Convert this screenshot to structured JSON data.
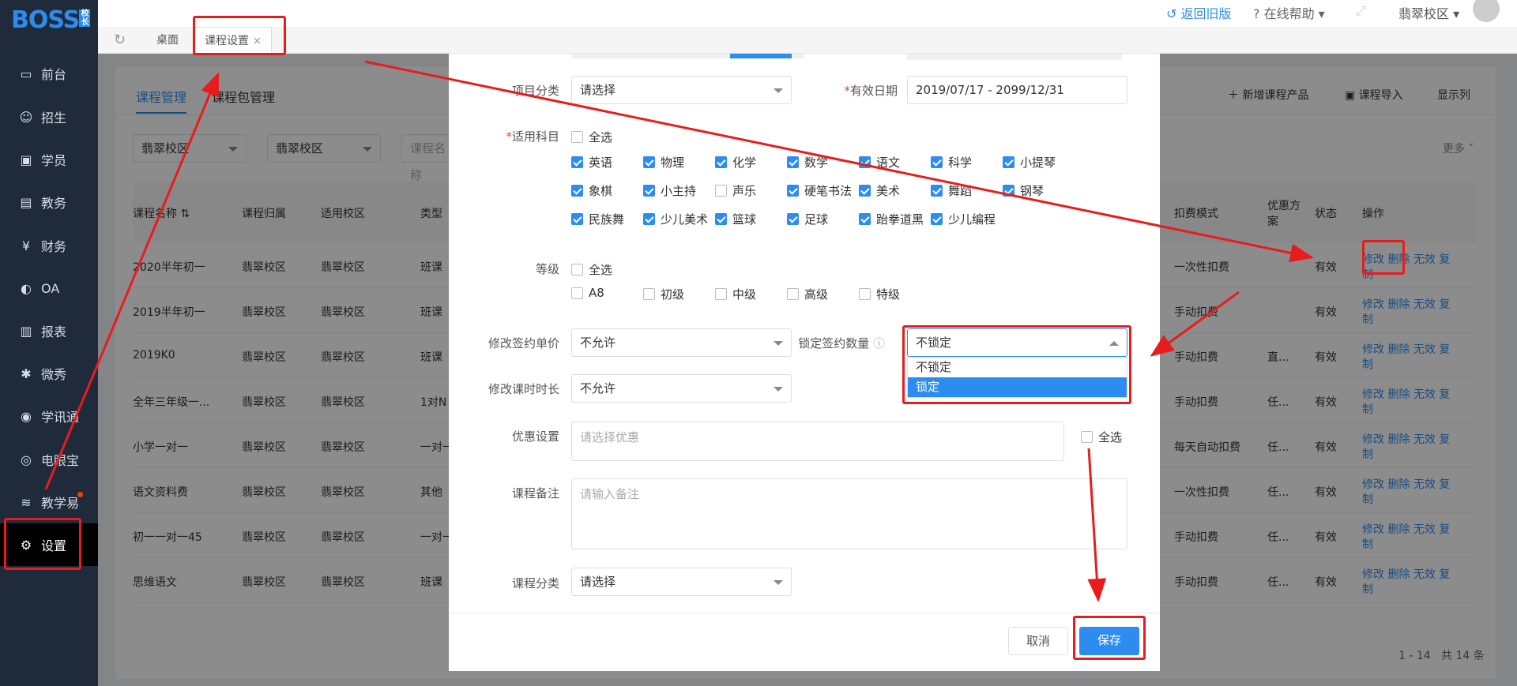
{
  "app": {
    "logo": "BOSS",
    "logo_sub": "校长"
  },
  "topbar": {
    "back": "返回旧版",
    "help": "在线帮助",
    "campus": "翡翠校区"
  },
  "tabs": [
    {
      "label": "桌面"
    },
    {
      "label": "课程设置"
    }
  ],
  "sidebar": {
    "items": [
      {
        "label": "前台",
        "icon": "monitor-icon"
      },
      {
        "label": "招生",
        "icon": "user-add-icon"
      },
      {
        "label": "学员",
        "icon": "id-card-icon"
      },
      {
        "label": "教务",
        "icon": "book-icon"
      },
      {
        "label": "财务",
        "icon": "yen-icon"
      },
      {
        "label": "OA",
        "icon": "toggle-icon"
      },
      {
        "label": "报表",
        "icon": "bar-chart-icon"
      },
      {
        "label": "微秀",
        "icon": "spark-icon"
      },
      {
        "label": "学讯通",
        "icon": "location-icon"
      },
      {
        "label": "电眼宝",
        "icon": "eye-icon"
      },
      {
        "label": "教学易",
        "icon": "layers-icon"
      },
      {
        "label": "设置",
        "icon": "gear-icon"
      }
    ]
  },
  "background": {
    "tabs": [
      "课程管理",
      "课程包管理"
    ],
    "filters": [
      "翡翠校区",
      "翡翠校区"
    ],
    "filter_placeholder": "课程名称",
    "actions": [
      "新增课程产品",
      "课程导入",
      "显示列"
    ],
    "more": "更多",
    "headers": [
      "课程名称",
      "课程归属",
      "适用校区",
      "类型",
      "扣费模式",
      "优惠方案",
      "状态",
      "操作"
    ],
    "rows": [
      [
        "2020半年初一",
        "翡翠校区",
        "翡翠校区",
        "班课",
        "一次性扣费",
        "",
        "有效"
      ],
      [
        "2019半年初一",
        "翡翠校区",
        "翡翠校区",
        "班课",
        "手动扣费",
        "",
        "有效"
      ],
      [
        "2019K0",
        "翡翠校区",
        "翡翠校区",
        "班课",
        "手动扣费",
        "直...",
        "有效"
      ],
      [
        "全年三年级一...",
        "翡翠校区",
        "翡翠校区",
        "1对N",
        "手动扣费",
        "任...",
        "有效"
      ],
      [
        "小学一对一",
        "翡翠校区",
        "翡翠校区",
        "一对一",
        "每天自动扣费",
        "任...",
        "有效"
      ],
      [
        "语文资料费",
        "翡翠校区",
        "翡翠校区",
        "其他",
        "一次性扣费",
        "任...",
        "有效"
      ],
      [
        "初一一对一45",
        "翡翠校区",
        "翡翠校区",
        "一对一",
        "手动扣费",
        "任...",
        "有效"
      ],
      [
        "思维语文",
        "翡翠校区",
        "翡翠校区",
        "班课",
        "手动扣费",
        "任...",
        "有效"
      ]
    ],
    "ops": [
      "修改",
      "删除",
      "无效",
      "复",
      "制"
    ],
    "pagination": "1 - 14   共 14 条"
  },
  "modal": {
    "category_label": "项目分类",
    "category_value": "请选择",
    "valid_label": "有效日期",
    "valid_value": "2019/07/17 - 2099/12/31",
    "subject_label": "适用科目",
    "all": "全选",
    "subjects": [
      {
        "label": "英语",
        "checked": true
      },
      {
        "label": "物理",
        "checked": true
      },
      {
        "label": "化学",
        "checked": true
      },
      {
        "label": "数学",
        "checked": true
      },
      {
        "label": "语文",
        "checked": true
      },
      {
        "label": "科学",
        "checked": true
      },
      {
        "label": "小提琴",
        "checked": true
      },
      {
        "label": "象棋",
        "checked": true
      },
      {
        "label": "小主持",
        "checked": true
      },
      {
        "label": "声乐",
        "checked": false
      },
      {
        "label": "硬笔书法",
        "checked": true
      },
      {
        "label": "美术",
        "checked": true
      },
      {
        "label": "舞蹈",
        "checked": true
      },
      {
        "label": "钢琴",
        "checked": true
      },
      {
        "label": "民族舞",
        "checked": true
      },
      {
        "label": "少儿美术",
        "checked": true
      },
      {
        "label": "篮球",
        "checked": true
      },
      {
        "label": "足球",
        "checked": true
      },
      {
        "label": "跆拳道黑",
        "checked": true
      },
      {
        "label": "少儿编程",
        "checked": true
      }
    ],
    "level_label": "等级",
    "levels": [
      "A8",
      "初级",
      "中级",
      "高级",
      "特级"
    ],
    "price_label": "修改签约单价",
    "price_value": "不允许",
    "lock_label": "锁定签约数量",
    "lock_value": "不锁定",
    "lock_options": [
      "不锁定",
      "锁定"
    ],
    "duration_label": "修改课时时长",
    "duration_value": "不允许",
    "discount_label": "优惠设置",
    "discount_placeholder": "请选择优惠",
    "remark_label": "课程备注",
    "remark_placeholder": "请输入备注",
    "course_cat_label": "课程分类",
    "course_cat_value": "请选择",
    "cancel": "取消",
    "save": "保存"
  },
  "colors": {
    "primary": "#2d8cf0",
    "annotation": "#e81c1c",
    "sidebar": "#1f2a3a"
  }
}
